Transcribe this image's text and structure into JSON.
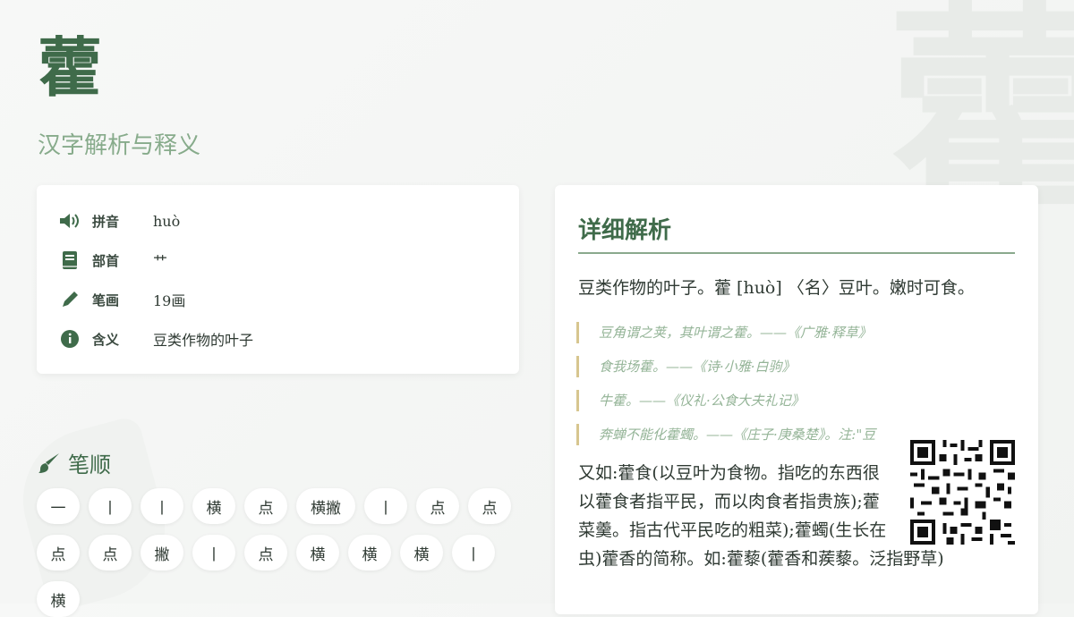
{
  "header": {
    "character": "藿",
    "subtitle": "汉字解析与释义"
  },
  "info": {
    "rows": [
      {
        "icon": "speaker-icon",
        "label": "拼音",
        "value": "huò"
      },
      {
        "icon": "book-icon",
        "label": "部首",
        "value": "艹"
      },
      {
        "icon": "pencil-icon",
        "label": "笔画",
        "value": "19画"
      },
      {
        "icon": "info-icon",
        "label": "含义",
        "value": "豆类作物的叶子"
      }
    ]
  },
  "strokes": {
    "title": "笔顺",
    "items": [
      "一",
      "丨",
      "丨",
      "横",
      "点",
      "横撇",
      "丨",
      "点",
      "点",
      "点",
      "点",
      "撇",
      "丨",
      "点",
      "横",
      "横",
      "横",
      "丨",
      "横"
    ]
  },
  "detail": {
    "title": "详细解析",
    "main": "豆类作物的叶子。藿 [huò] 〈名〉豆叶。嫩时可食。",
    "quotes": [
      "豆角谓之荚，其叶谓之藿。——《广雅·释草》",
      "食我场藿。——《诗·小雅·白驹》",
      "牛藿。——《仪礼·公食大夫礼记》",
      "奔蝉不能化藿蠋。——《庄子·庚桑楚》。注:\"豆"
    ],
    "body_lines": [
      "又如:藿食(以豆叶为食物。指吃的东西很",
      "以藿食者指平民，而以肉食者指贵族);藿",
      "菜羹。指古代平民吃的粗菜);藿蠋(生长在",
      "虫)藿香的简称。如:藿藜(藿香和蒺藜。泛指野草)"
    ]
  },
  "colors": {
    "accent": "#3f6b4a",
    "subtitle": "#87ab8b",
    "quote_border": "#d7c68f"
  }
}
